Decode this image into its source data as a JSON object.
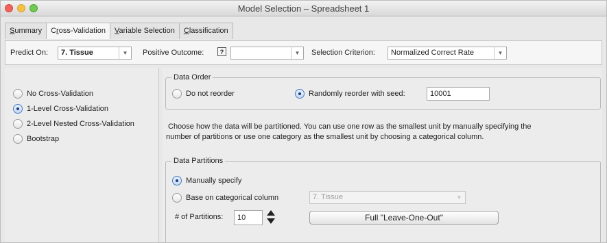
{
  "window": {
    "title": "Model Selection – Spreadsheet 1"
  },
  "tabs": [
    {
      "label": "Summary",
      "mnemonic": "S",
      "rest": "ummary"
    },
    {
      "label": "Cross-Validation",
      "pre": "C",
      "mnemonic": "r",
      "rest": "oss-Validation",
      "active": true
    },
    {
      "label": "Variable Selection",
      "mnemonic": "V",
      "rest": "ariable Selection"
    },
    {
      "label": "Classification",
      "mnemonic": "C",
      "rest": "lassification"
    }
  ],
  "predict": {
    "predict_on_label": "Predict On:",
    "predict_on_value": "7. Tissue",
    "positive_outcome_label": "Positive Outcome:",
    "positive_outcome_value": "",
    "selection_criterion_label": "Selection Criterion:",
    "selection_criterion_value": "Normalized Correct Rate"
  },
  "validation_methods": [
    {
      "label": "No Cross-Validation",
      "selected": false
    },
    {
      "label": "1-Level Cross-Validation",
      "selected": true
    },
    {
      "label": "2-Level Nested Cross-Validation",
      "selected": false
    },
    {
      "label": "Bootstrap",
      "selected": false
    }
  ],
  "data_order": {
    "legend": "Data Order",
    "do_not_reorder_label": "Do not reorder",
    "randomly_reorder_label": "Randomly reorder with seed:",
    "seed_value": "10001",
    "selected": "randomly_reorder"
  },
  "description": {
    "line1": "Choose how the data will be partitioned. You can use one row as the smallest unit by manually specifying the",
    "line2": "number of partitions or use one category as the smallest unit by choosing a categorical column."
  },
  "data_partitions": {
    "legend": "Data Partitions",
    "manually_specify_label": "Manually specify",
    "base_on_column_label": "Base on categorical column",
    "column_value": "7. Tissue",
    "num_partitions_label": "# of Partitions:",
    "num_partitions_value": "10",
    "leave_one_out_label": "Full \"Leave-One-Out\"",
    "selected": "manually_specify"
  },
  "colors": {
    "accent": "#4a7bc4",
    "tab_active": "#f6f6f6",
    "panel_bg": "#ececec"
  }
}
